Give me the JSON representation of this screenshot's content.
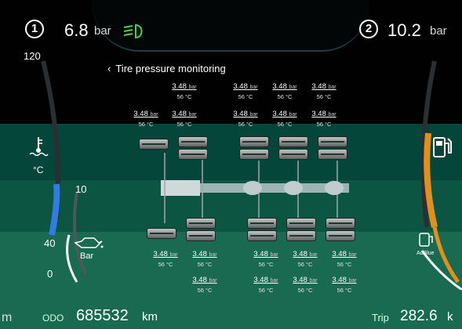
{
  "header": {
    "left_indicator_number": "1",
    "left_pressure": "6.8",
    "left_unit": "bar",
    "right_indicator_number": "2",
    "right_pressure": "10.2",
    "right_unit": "bar",
    "headlight_icon": "low-beam-headlight-icon",
    "headlight_color": "#4cd34c"
  },
  "panel": {
    "back_icon": "chevron-left-icon",
    "title": "Tire pressure monitoring"
  },
  "left_gauge": {
    "top_label": "120",
    "mid_label": "10",
    "lower_label": "40",
    "bottom_label": "0",
    "temp_icon": "coolant-temperature-icon",
    "temp_unit": "°C",
    "oil_icon": "oil-pressure-icon",
    "oil_unit": "Bar",
    "accent_color": "#2f7de0"
  },
  "right_gauge": {
    "fuel_icon": "fuel-pump-icon",
    "adblue_icon": "adblue-icon",
    "adblue_label": "AdBlue",
    "fuel_color": "#e0901e"
  },
  "tires_top_row1": [
    {
      "pressure": "3.48",
      "unit": "bar",
      "temp": "56 °C"
    },
    {
      "pressure": "3.48",
      "unit": "bar",
      "temp": "56 °C"
    },
    {
      "pressure": "3.48",
      "unit": "bar",
      "temp": "56 °C"
    },
    {
      "pressure": "3.48",
      "unit": "bar",
      "temp": "56 °C"
    }
  ],
  "tires_top_row2": [
    {
      "pressure": "3.48",
      "unit": "bar",
      "temp": "56 °C"
    },
    {
      "pressure": "3.48",
      "unit": "bar",
      "temp": "56 °C"
    },
    {
      "pressure": "3.48",
      "unit": "bar",
      "temp": "56 °C"
    },
    {
      "pressure": "3.48",
      "unit": "bar",
      "temp": "56 °C"
    },
    {
      "pressure": "3.48",
      "unit": "bar",
      "temp": "56 °C"
    }
  ],
  "tires_bottom_row1": [
    {
      "pressure": "3.48",
      "unit": "bar",
      "temp": "56 °C"
    },
    {
      "pressure": "3.48",
      "unit": "bar",
      "temp": "56 °C"
    },
    {
      "pressure": "3.48",
      "unit": "bar",
      "temp": "56 °C"
    },
    {
      "pressure": "3.48",
      "unit": "bar",
      "temp": "56 °C"
    },
    {
      "pressure": "3.48",
      "unit": "bar",
      "temp": "56 °C"
    }
  ],
  "tires_bottom_row2": [
    {
      "pressure": "3.48",
      "unit": "bar",
      "temp": "56 °C"
    },
    {
      "pressure": "3.48",
      "unit": "bar",
      "temp": "56 °C"
    },
    {
      "pressure": "3.48",
      "unit": "bar",
      "temp": "56 °C"
    },
    {
      "pressure": "3.48",
      "unit": "bar",
      "temp": "56 °C"
    }
  ],
  "footer": {
    "left_fragment": "m",
    "odo_label": "ODO",
    "odo_value": "685532",
    "odo_unit": "km",
    "trip_label": "Trip",
    "trip_value": "282.6",
    "trip_unit_fragment": "k"
  }
}
